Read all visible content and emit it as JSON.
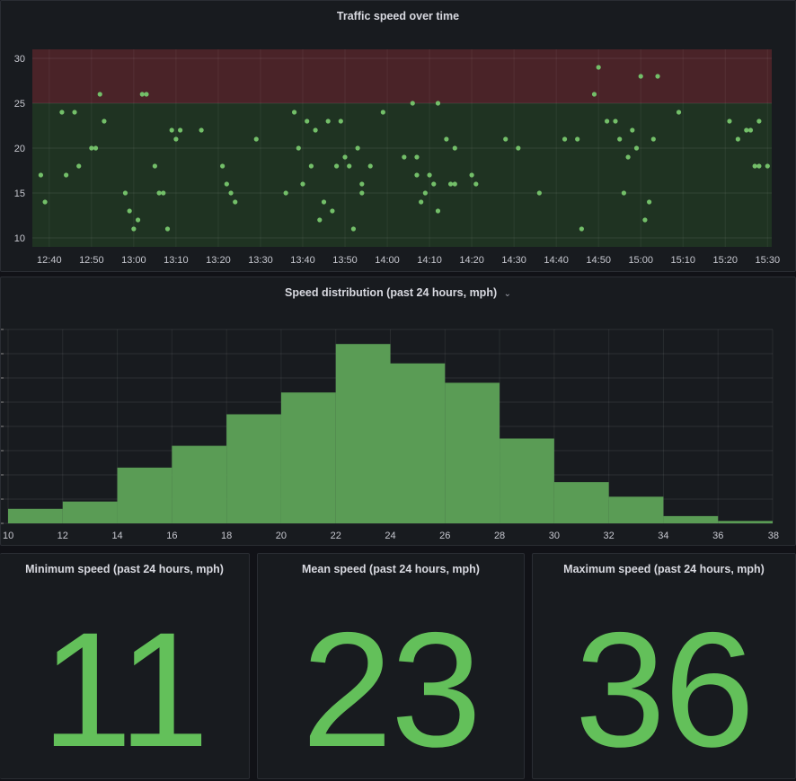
{
  "colors": {
    "background": "#111217",
    "panel": "#181b1f",
    "green": "#73bf69",
    "green_bar": "#5a9c55",
    "stat_green": "#63c05a",
    "red_band": "#4a2328",
    "green_band": "#1f3322"
  },
  "panels": {
    "scatter": {
      "title": "Traffic speed over time"
    },
    "histogram": {
      "title": "Speed distribution (past 24 hours, mph)",
      "menu_icon": "chevron-down-icon"
    },
    "min": {
      "title": "Minimum speed (past 24 hours, mph)",
      "value": "11"
    },
    "mean": {
      "title": "Mean speed (past 24 hours, mph)",
      "value": "23"
    },
    "max": {
      "title": "Maximum speed (past 24 hours, mph)",
      "value": "36"
    }
  },
  "chart_data": [
    {
      "type": "scatter",
      "title": "Traffic speed over time",
      "x_ticks": [
        "12:40",
        "12:50",
        "13:00",
        "13:10",
        "13:20",
        "13:30",
        "13:40",
        "13:50",
        "14:00",
        "14:10",
        "14:20",
        "14:30",
        "14:40",
        "14:50",
        "15:00",
        "15:10",
        "15:20",
        "15:30"
      ],
      "y_ticks": [
        10,
        15,
        20,
        25,
        30
      ],
      "ylim": [
        9,
        31
      ],
      "xlim": [
        "12:36",
        "15:31"
      ],
      "thresholds": [
        {
          "from": 9,
          "to": 25,
          "color": "green"
        },
        {
          "from": 25,
          "to": 31,
          "color": "red"
        }
      ],
      "points": [
        [
          "12:38",
          17
        ],
        [
          "12:39",
          14
        ],
        [
          "12:43",
          24
        ],
        [
          "12:44",
          17
        ],
        [
          "12:46",
          24
        ],
        [
          "12:47",
          18
        ],
        [
          "12:50",
          20
        ],
        [
          "12:51",
          20
        ],
        [
          "12:52",
          26
        ],
        [
          "12:53",
          23
        ],
        [
          "12:58",
          15
        ],
        [
          "12:59",
          13
        ],
        [
          "13:00",
          11
        ],
        [
          "13:01",
          12
        ],
        [
          "13:02",
          26
        ],
        [
          "13:03",
          26
        ],
        [
          "13:05",
          18
        ],
        [
          "13:06",
          15
        ],
        [
          "13:07",
          15
        ],
        [
          "13:08",
          11
        ],
        [
          "13:09",
          22
        ],
        [
          "13:10",
          21
        ],
        [
          "13:11",
          22
        ],
        [
          "13:16",
          22
        ],
        [
          "13:21",
          18
        ],
        [
          "13:22",
          16
        ],
        [
          "13:23",
          15
        ],
        [
          "13:24",
          14
        ],
        [
          "13:29",
          21
        ],
        [
          "13:36",
          15
        ],
        [
          "13:38",
          24
        ],
        [
          "13:39",
          20
        ],
        [
          "13:40",
          16
        ],
        [
          "13:41",
          23
        ],
        [
          "13:42",
          18
        ],
        [
          "13:43",
          22
        ],
        [
          "13:44",
          12
        ],
        [
          "13:45",
          14
        ],
        [
          "13:46",
          23
        ],
        [
          "13:47",
          13
        ],
        [
          "13:48",
          18
        ],
        [
          "13:49",
          23
        ],
        [
          "13:50",
          19
        ],
        [
          "13:51",
          18
        ],
        [
          "13:52",
          11
        ],
        [
          "13:53",
          20
        ],
        [
          "13:54",
          15
        ],
        [
          "13:54",
          16
        ],
        [
          "13:56",
          18
        ],
        [
          "13:59",
          24
        ],
        [
          "14:04",
          19
        ],
        [
          "14:06",
          25
        ],
        [
          "14:07",
          19
        ],
        [
          "14:07",
          17
        ],
        [
          "14:08",
          14
        ],
        [
          "14:09",
          15
        ],
        [
          "14:10",
          17
        ],
        [
          "14:11",
          16
        ],
        [
          "14:12",
          25
        ],
        [
          "14:12",
          13
        ],
        [
          "14:14",
          21
        ],
        [
          "14:15",
          16
        ],
        [
          "14:16",
          20
        ],
        [
          "14:16",
          16
        ],
        [
          "14:20",
          17
        ],
        [
          "14:21",
          16
        ],
        [
          "14:28",
          21
        ],
        [
          "14:31",
          20
        ],
        [
          "14:36",
          15
        ],
        [
          "14:42",
          21
        ],
        [
          "14:45",
          21
        ],
        [
          "14:46",
          11
        ],
        [
          "14:49",
          26
        ],
        [
          "14:50",
          29
        ],
        [
          "14:52",
          23
        ],
        [
          "14:54",
          23
        ],
        [
          "14:55",
          21
        ],
        [
          "14:56",
          15
        ],
        [
          "14:57",
          19
        ],
        [
          "14:58",
          22
        ],
        [
          "14:59",
          20
        ],
        [
          "15:00",
          28
        ],
        [
          "15:01",
          12
        ],
        [
          "15:02",
          14
        ],
        [
          "15:03",
          21
        ],
        [
          "15:04",
          28
        ],
        [
          "15:09",
          24
        ],
        [
          "15:21",
          23
        ],
        [
          "15:23",
          21
        ],
        [
          "15:25",
          22
        ],
        [
          "15:26",
          22
        ],
        [
          "15:27",
          18
        ],
        [
          "15:28",
          18
        ],
        [
          "15:28",
          23
        ],
        [
          "15:30",
          18
        ]
      ]
    },
    {
      "type": "bar",
      "title": "Speed distribution (past 24 hours, mph)",
      "x_ticks": [
        10,
        12,
        14,
        16,
        18,
        20,
        22,
        24,
        26,
        28,
        30,
        32,
        34,
        36,
        38
      ],
      "bins": [
        [
          10,
          12
        ],
        [
          12,
          14
        ],
        [
          14,
          16
        ],
        [
          16,
          18
        ],
        [
          18,
          20
        ],
        [
          20,
          22
        ],
        [
          22,
          24
        ],
        [
          24,
          26
        ],
        [
          26,
          28
        ],
        [
          28,
          30
        ],
        [
          30,
          32
        ],
        [
          32,
          34
        ],
        [
          34,
          36
        ],
        [
          36,
          38
        ]
      ],
      "values": [
        6,
        9,
        23,
        32,
        45,
        54,
        74,
        66,
        58,
        35,
        17,
        11,
        3,
        1
      ],
      "ylim": [
        0,
        80
      ],
      "y_gridlines": 8,
      "grid": true
    }
  ]
}
